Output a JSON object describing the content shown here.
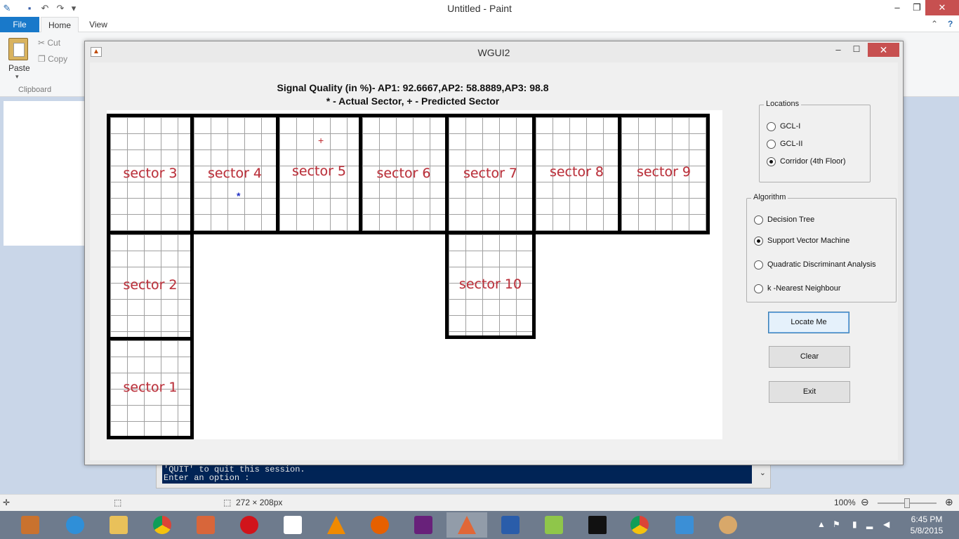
{
  "paint": {
    "title": "Untitled - Paint",
    "tabs": {
      "file": "File",
      "home": "Home",
      "view": "View"
    },
    "clipboard": {
      "paste": "Paste",
      "cut": "Cut",
      "copy": "Copy",
      "group_label": "Clipboard"
    },
    "status": {
      "image_size": "272 × 208px",
      "zoom": "100%"
    }
  },
  "cmd": {
    "line1": "'QUIT' to quit this session.",
    "line2": "Enter an option :"
  },
  "wgui": {
    "title": "WGUI2",
    "plot_title_line1": "Signal Quality (in %)- AP1: 92.6667,AP2: 58.8889,AP3: 98.8",
    "plot_title_line2": "* - Actual Sector, + - Predicted Sector",
    "sectors": {
      "s1": "sector 1",
      "s2": "sector 2",
      "s3": "sector 3",
      "s4": "sector 4",
      "s5": "sector 5",
      "s6": "sector 6",
      "s7": "sector 7",
      "s8": "sector 8",
      "s9": "sector 9",
      "s10": "sector 10"
    },
    "markers": {
      "actual": "*",
      "predicted": "+",
      "actual_sector": "sector 4",
      "predicted_sector": "sector 5"
    },
    "locations": {
      "title": "Locations",
      "options": [
        "GCL-I",
        "GCL-II",
        "Corridor (4th Floor)"
      ],
      "selected": "Corridor (4th Floor)"
    },
    "algorithm": {
      "title": "Algorithm",
      "options": [
        "Decision Tree",
        "Support Vector Machine",
        "Quadratic Discriminant Analysis",
        "k -Nearest Neighbour"
      ],
      "selected": "Support Vector Machine"
    },
    "buttons": {
      "locate": "Locate Me",
      "clear": "Clear",
      "exit": "Exit"
    }
  },
  "colors": {
    "sector_label": "#b8323c",
    "actual_marker": "#1f2fc4",
    "predicted_marker": "#c0282d",
    "accent": "#1979ca"
  },
  "taskbar": {
    "time": "6:45 PM",
    "date": "5/8/2015",
    "apps": [
      "start-icon",
      "internet-explorer-icon",
      "file-explorer-icon",
      "chrome-icon",
      "firefox-icon-alt",
      "opera-icon",
      "tex-icon",
      "vlc-icon",
      "firefox-icon",
      "visual-studio-icon",
      "matlab-icon",
      "powershell-icon",
      "notepad-icon",
      "command-prompt-icon",
      "chrome-icon",
      "photos-icon",
      "paint-icon"
    ]
  }
}
